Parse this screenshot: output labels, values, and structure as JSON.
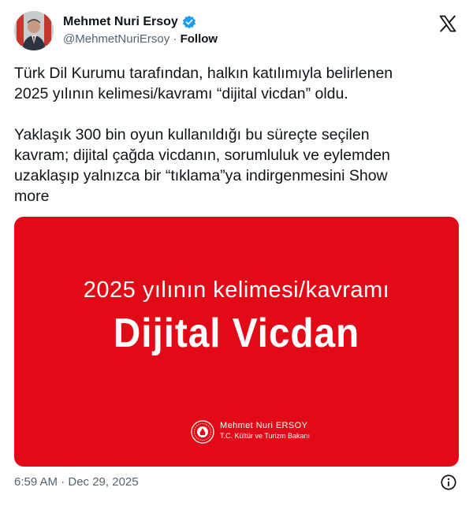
{
  "author": {
    "name": "Mehmet Nuri Ersoy",
    "handle": "@MehmetNuriErsoy",
    "separator": "·",
    "follow_label": "Follow",
    "verified_icon": "verified-badge-icon",
    "verified_color": "#1d9bf0"
  },
  "tweet": {
    "text": "Türk Dil Kurumu tarafından, halkın katılımıyla belirlenen\n2025 yılının kelimesi/kavramı “dijital vicdan” oldu.\n\nYaklaşık 300 bin oyun kullanıldığı bu süreçte seçilen\nkavram; dijital çağda vicdanın, sorumluluk ve eylemden\nuzaklaşıp yalnızca bir “tıklama”ya indirgenmesini",
    "show_more_label": "Show\nmore"
  },
  "media": {
    "line1": "2025 yılının kelimesi/kavramı",
    "line2": "Dijital Vicdan",
    "signature_name": "Mehmet Nuri ERSOY",
    "signature_title": "T.C. Kültür ve Turizm Bakanı",
    "background_color": "#e20a17"
  },
  "footer": {
    "timestamp": "6:59 AM · Dec 29, 2025"
  },
  "icons": {
    "platform": "x-logo-icon",
    "info": "info-icon"
  }
}
